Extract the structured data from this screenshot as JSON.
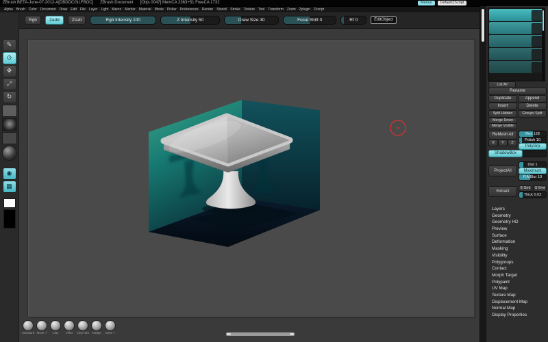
{
  "titlebar": {
    "title": "ZBrush BETA-June-07-2012-A[DBDDCGILFBOC]",
    "document_label": "ZBrush Document",
    "stats": "[Objs 0047]  MemCA 2363+51  FreeCA 1732",
    "menus_badge": "Menus",
    "script_badge": "DefaultZScript"
  },
  "menubar": {
    "items": [
      "Alpha",
      "Brush",
      "Color",
      "Document",
      "Draw",
      "Edit",
      "File",
      "Layer",
      "Light",
      "Macro",
      "Marker",
      "Material",
      "Movie",
      "Picker",
      "Preferences",
      "Render",
      "Stencil",
      "Stroke",
      "Texture",
      "Tool",
      "Transform",
      "Zoom",
      "Zplugin",
      "Zscript"
    ]
  },
  "toolbar": {
    "mode_buttons": [
      {
        "label": "Rgb"
      },
      {
        "label": "Zadd"
      },
      {
        "label": "Zsub"
      }
    ],
    "sliders": [
      {
        "label": "Rgb Intensity 100"
      },
      {
        "label": "Z Intensity 50"
      },
      {
        "label": "Draw Size 30"
      },
      {
        "label": "Focal Shift 0"
      },
      {
        "label": "Rf 0"
      }
    ],
    "edit_object": "EditObject"
  },
  "left_tray": {
    "tools": [
      {
        "glyph": "✎"
      },
      {
        "glyph": "⊙"
      },
      {
        "glyph": "✥"
      },
      {
        "glyph": "⤢"
      },
      {
        "glyph": "↻"
      }
    ],
    "stroke_glyph": "◉",
    "grid_glyph": "▦"
  },
  "tool_panel": {
    "subtool_count": 5,
    "list_all": "List All",
    "rename": "Rename",
    "duplicate": "Duplicate",
    "append": "Append",
    "insert": "Insert",
    "delete": "Delete",
    "split_hidden": "Split Hidden",
    "groups_split": "Groups Split",
    "merge_down": "Merge Down",
    "merge_visible": "Merge Visible",
    "remesh_all": "ReMesh All",
    "sym_x": "X",
    "sym_y": "Y",
    "sym_z": "Z",
    "res_slider": "Res 128",
    "polish_slider": "Polish 10",
    "polygrp": "PolyGrp",
    "shadowbox": "ShadowBox",
    "project_all": "ProjectAll",
    "dist_slider": "Dist 1",
    "maximum": "Maximum",
    "pa_blur_slider": "P.A Blur 10",
    "e_smt": "E Smt",
    "s_smt": "S Smt",
    "thick_slider": "Thick 0.02",
    "extract": "Extract",
    "sections": [
      "Layers",
      "Geometry",
      "Geometry HD",
      "Preview",
      "Surface",
      "Deformation",
      "Masking",
      "Visibility",
      "Polygroups",
      "Contact",
      "Morph Target",
      "Polypaint",
      "UV Map",
      "Texture Map",
      "Displacement Map",
      "Normal Map",
      "Display Properties"
    ]
  },
  "brush_tray": {
    "brushes": [
      "Standard",
      "Move T",
      "Clay",
      "Inflat",
      "ClayTube",
      "Nudge",
      "More T"
    ]
  },
  "colors": {
    "accent": "#5fc9d3",
    "active_tool": "#8fdbe2",
    "cursor": "#cc3333",
    "canvas": "#4a4a4a"
  }
}
